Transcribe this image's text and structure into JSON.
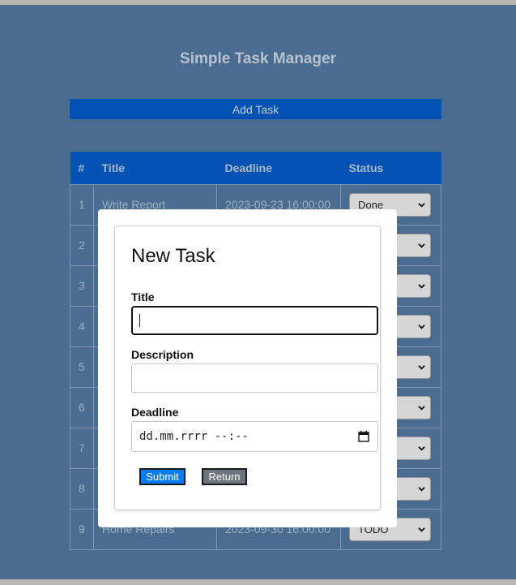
{
  "app": {
    "title": "Simple Task Manager",
    "add_task_label": "Add Task"
  },
  "table": {
    "headers": {
      "num": "#",
      "title": "Title",
      "deadline": "Deadline",
      "status": "Status"
    },
    "rows": [
      {
        "num": "1",
        "title": "Write Report",
        "deadline": "2023-09-23 16:00:00",
        "status": "Done"
      },
      {
        "num": "2",
        "title": "",
        "deadline": "",
        "status": "ess"
      },
      {
        "num": "3",
        "title": "",
        "deadline": "",
        "status": ""
      },
      {
        "num": "4",
        "title": "",
        "deadline": "",
        "status": ""
      },
      {
        "num": "5",
        "title": "",
        "deadline": "",
        "status": ""
      },
      {
        "num": "6",
        "title": "",
        "deadline": "",
        "status": "ess"
      },
      {
        "num": "7",
        "title": "",
        "deadline": "",
        "status": ""
      },
      {
        "num": "8",
        "title": "",
        "deadline": "",
        "status": ""
      },
      {
        "num": "9",
        "title": "Home Repairs",
        "deadline": "2023-09-30 16:00:00",
        "status": "TODO"
      }
    ]
  },
  "modal": {
    "title": "New Task",
    "title_label": "Title",
    "title_value": "",
    "description_label": "Description",
    "description_value": "",
    "deadline_label": "Deadline",
    "deadline_placeholder": "dd.mm.rrrr --:--",
    "submit_label": "Submit",
    "return_label": "Return"
  }
}
